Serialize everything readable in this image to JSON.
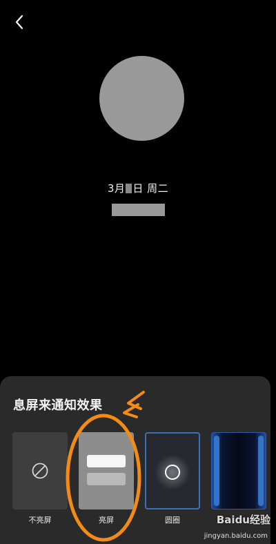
{
  "header": {
    "back_icon": "chevron-left-icon"
  },
  "preview": {
    "date_prefix": "3月",
    "date_suffix": "日 周二"
  },
  "sheet": {
    "title": "息屏来通知效果",
    "options": [
      {
        "label": "不亮屏",
        "icon": "prohibited-icon"
      },
      {
        "label": "亮屏",
        "icon": "notification-bars-icon"
      },
      {
        "label": "圆圈",
        "icon": "ring-icon"
      },
      {
        "label": "",
        "icon": "edge-glow-icon"
      }
    ]
  },
  "annotation": {
    "color": "#F28C16"
  },
  "watermark": {
    "logo": "Baidu经验",
    "url": "jingyan.baidu.com"
  }
}
